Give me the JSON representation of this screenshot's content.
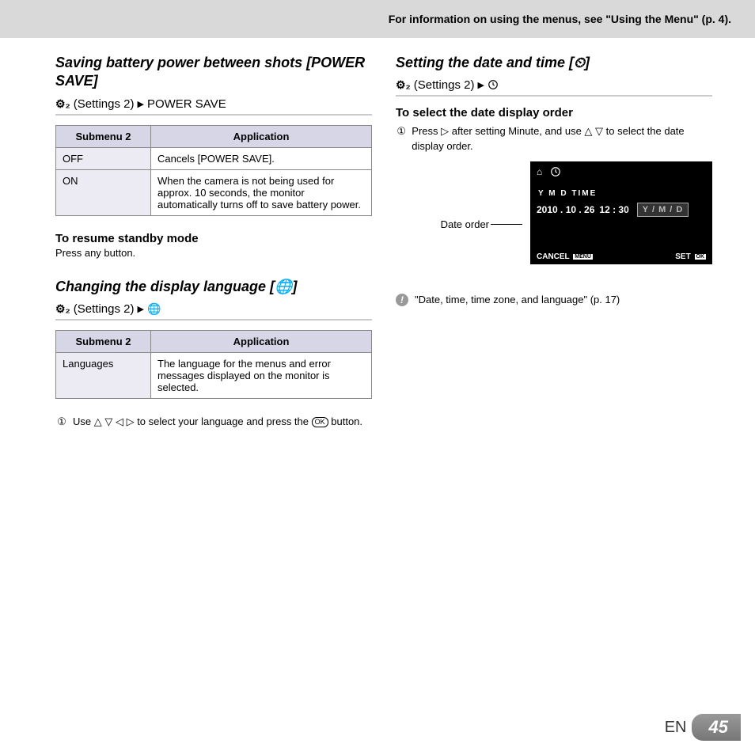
{
  "header": {
    "text": "For information on using the menus, see \"Using the Menu\" (p. 4)."
  },
  "settings_label": "(Settings 2)",
  "settings_prefix": "⚙₂",
  "triangle": "▶",
  "powerSave": {
    "title": "Saving battery power between shots [POWER SAVE]",
    "crumb_end": "POWER SAVE",
    "th1": "Submenu 2",
    "th2": "Application",
    "rows": [
      {
        "k": "OFF",
        "v": "Cancels [POWER SAVE]."
      },
      {
        "k": "ON",
        "v": "When the camera is not being used for approx. 10 seconds, the monitor automatically turns off to save battery power."
      }
    ],
    "resume_h": "To resume standby mode",
    "resume_t": "Press any button."
  },
  "language": {
    "title": "Changing the display language [🌐]",
    "th1": "Submenu 2",
    "th2": "Application",
    "rows": [
      {
        "k": "Languages",
        "v": "The language for the menus and error messages displayed on the monitor is selected."
      }
    ],
    "step_num": "①",
    "step_pre": "Use ",
    "step_arrows": "△ ▽ ◁ ▷",
    "step_mid": " to select your language and press the ",
    "step_ok": "OK",
    "step_post": " button."
  },
  "datetime": {
    "title": "Setting the date and time [⏲]",
    "sub_h": "To select the date display order",
    "step_num": "①",
    "step_a": "Press ",
    "step_arr1": "▷",
    "step_b": " after setting Minute, and use ",
    "step_arr2": "△ ▽",
    "step_c": " to select the date display order.",
    "lcd": {
      "home": "⌂",
      "labels": "Y    M   D    TIME",
      "date": "2010 . 10 . 26",
      "time": "12 : 30",
      "order": "Y / M / D",
      "cancel": "CANCEL",
      "menu": "MENU",
      "set": "SET",
      "ok": "OK"
    },
    "pointer": "Date order",
    "note": "\"Date, time, time zone, and language\" (p. 17)"
  },
  "footer": {
    "lang": "EN",
    "page": "45"
  }
}
